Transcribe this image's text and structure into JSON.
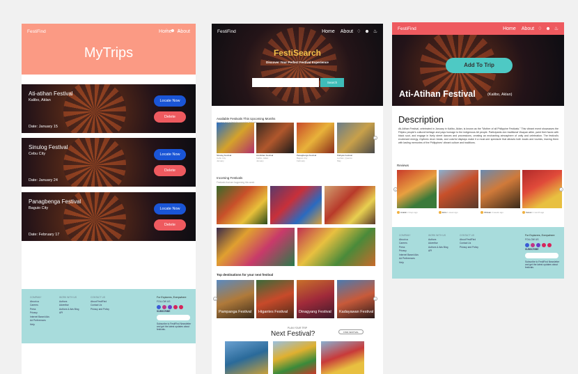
{
  "colors": {
    "salmon": "#fb9a84",
    "coral_nav": "#ee5a5f",
    "teal": "#4ec9c4",
    "footer_teal": "#a8dcdc",
    "locate_blue": "#1a55d6",
    "gold_title": "#f3c04a"
  },
  "mytrips": {
    "brand": "FestiFind",
    "nav": {
      "home": "Home",
      "about": "About"
    },
    "title": "MyTrips",
    "trips": [
      {
        "name": "Ati-atihan Festival",
        "city": "Kalibo, Aklan",
        "date": "Date: January 15",
        "locate": "Locate Now",
        "delete": "Delete"
      },
      {
        "name": "Sinulog Festival",
        "city": "Cebu City",
        "date": "Date: January 24",
        "locate": "Locate Now",
        "delete": "Delete"
      },
      {
        "name": "Panagbenga Festival",
        "city": "Baguio City",
        "date": "Date: February 17",
        "locate": "Locate Now",
        "delete": "Delete"
      }
    ]
  },
  "footer": {
    "col1_head": "COMPANY",
    "col1": [
      "About us",
      "Careers",
      "Press",
      "Privacy",
      "Internet Based Ads",
      "Ad Preferences",
      "Help"
    ],
    "col2_head": "WORK WITH US",
    "col2": [
      "Authors",
      "Advertise",
      "Authors & Ads Blog",
      "API"
    ],
    "col3_head": "CONTACT US",
    "col3": [
      "About FestiFind",
      "Contact Us",
      "Privacy and Policy"
    ],
    "col4_head": "For Explorers, Everywhere",
    "follow": "FOLLOW US",
    "subscribe": "SUBSCRIBE",
    "fine_print": "Subscribe to FestiFind Newsletter and get the latest updates about festivals."
  },
  "festisearch": {
    "brand": "FestiFind",
    "nav": {
      "home": "Home",
      "about": "About"
    },
    "title": "FestiSearch",
    "subtitle": "Discover Your Perfect Festival Experience",
    "search_placeholder": "",
    "search_btn": "Search",
    "upcoming_title": "Available Festivals This Upcoming Months",
    "upcoming_sub": "Browse and schedule upcoming festivals",
    "upcoming": [
      {
        "name": "Sinulog Festival",
        "loc": "Cebu City",
        "month": "January"
      },
      {
        "name": "Ati-Atihan Festival",
        "loc": "Kalibo, Aklan",
        "month": "January"
      },
      {
        "name": "Panagbenga Festival",
        "loc": "Baguio City",
        "month": "February"
      },
      {
        "name": "Pahiyas Festival",
        "loc": "Lucban, Quezon",
        "month": "May"
      }
    ],
    "incoming_title": "Incoming Festivals",
    "incoming_sub": "Festivals that are happening this week",
    "top_title": "Top destinations for your next festival",
    "destinations": [
      {
        "name": "Pampanga Festival"
      },
      {
        "name": "Higantes Festival"
      },
      {
        "name": "Dinagyang Festival"
      },
      {
        "name": "Kadayawan Festival"
      }
    ],
    "next_small": "PLAN YOUR TRIP",
    "next_title": "Next Festival?",
    "next_pill": "FIND FESTIVAL"
  },
  "detail": {
    "brand": "FestiFind",
    "nav": {
      "home": "Home",
      "about": "About"
    },
    "add_btn": "Add To Trip",
    "title": "Ati-Atihan Festival",
    "location": "(Kalibo, Aklan)",
    "desc_head": "Description",
    "description": "Ati-Atihan Festival, celebrated in January in Kalibo, Aklan, is known as the \"Mother of all Philippine Festivals.\" This vibrant event showcases the Filipino people's cultural heritage and pays homage to the indigenous Ati people. Participants don traditional Visayan attire, paint their faces with black soot, and engage in lively street dances and processions, creating an enchanting atmosphere of unity and celebration. The festival's exuberant energy, rhythmic drum beats, and colorful displays make it a must-see spectacle that attracts both locals and tourists, leaving them with lasting memories of the Philippines' vibrant culture and traditions.",
    "reviews_head": "Reviews",
    "reviews": [
      {
        "name": "Anakin",
        "time": "2 days ago"
      },
      {
        "name": "Ezra",
        "time": "1 week ago"
      },
      {
        "name": "Obiwan",
        "time": "2 weeks ago"
      },
      {
        "name": "Kanan",
        "time": "1 month ago"
      }
    ]
  }
}
